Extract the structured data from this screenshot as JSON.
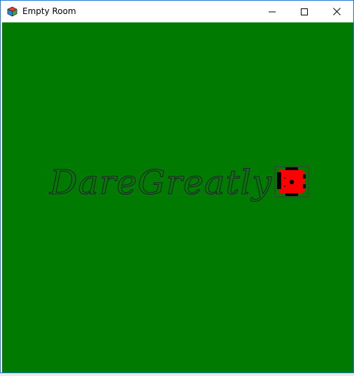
{
  "window": {
    "title": "Empty Room"
  },
  "titlebar": {
    "icon": "app-cube-icon",
    "buttons": [
      "minimize-icon",
      "maximize-icon",
      "close-icon"
    ]
  },
  "room": {
    "background_color": "#007a00",
    "text": "DareGreatly",
    "text_color": "#2a1a38",
    "robot": {
      "icon": "robot-icon",
      "body_color": "#ff0000",
      "frame_color": "#2f4f2f"
    }
  }
}
